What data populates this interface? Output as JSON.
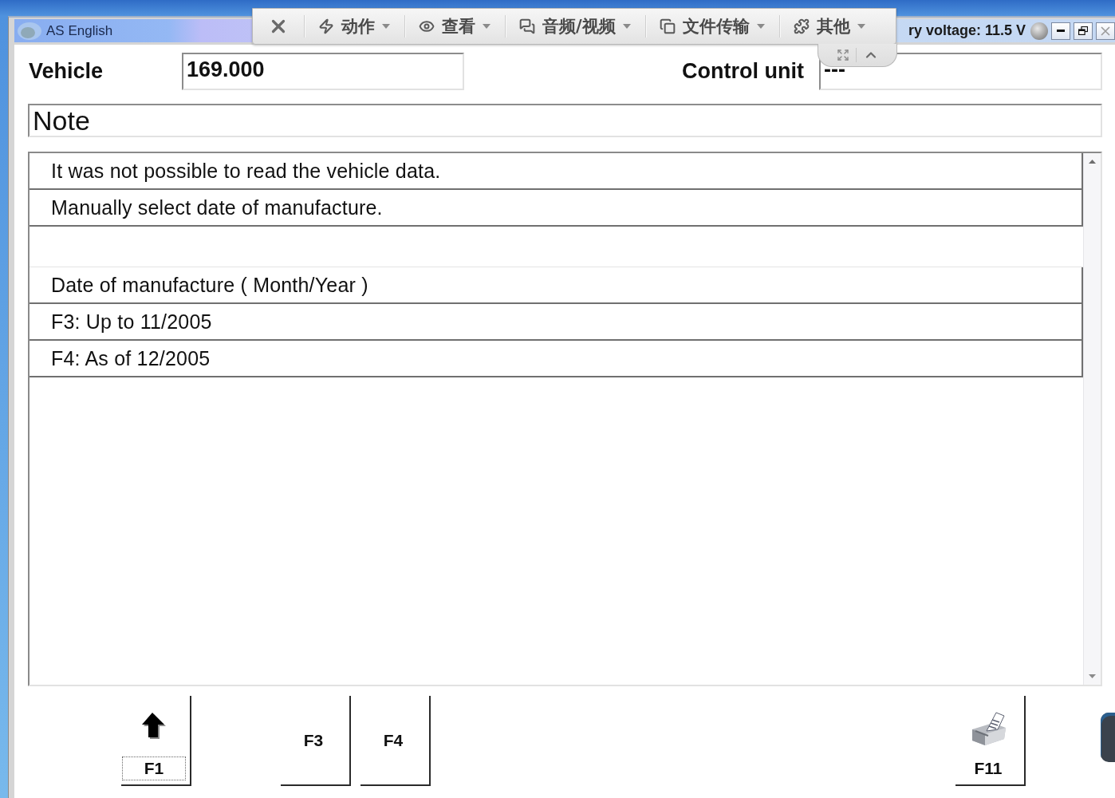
{
  "window": {
    "title": "AS English",
    "status_text": "ry voltage: 11.5 V"
  },
  "remote_toolbar": {
    "items": [
      {
        "label": "动作"
      },
      {
        "label": "查看"
      },
      {
        "label": "音频/视频"
      },
      {
        "label": "文件传输"
      },
      {
        "label": "其他"
      }
    ]
  },
  "header": {
    "vehicle": {
      "label": "Vehicle",
      "value": "169.000"
    },
    "control_unit": {
      "label": "Control unit",
      "value": "---"
    }
  },
  "note": {
    "title": "Note"
  },
  "message_list": {
    "rows": [
      {
        "kind": "text",
        "text": "It was not possible to read the vehicle data."
      },
      {
        "kind": "text",
        "text": "Manually select date of manufacture."
      },
      {
        "kind": "blank"
      },
      {
        "kind": "text",
        "text": "Date of manufacture ( Month/Year )"
      },
      {
        "kind": "text",
        "text": "F3: Up to 11/2005"
      },
      {
        "kind": "text",
        "text": "F4: As of 12/2005"
      }
    ]
  },
  "function_keys": [
    {
      "key": "F1",
      "kind": "arrow",
      "focused": true
    },
    {
      "key": "F3",
      "kind": "plain",
      "focused": false
    },
    {
      "key": "F4",
      "kind": "plain",
      "focused": false
    },
    {
      "key": "F11",
      "kind": "printer",
      "focused": false
    }
  ]
}
